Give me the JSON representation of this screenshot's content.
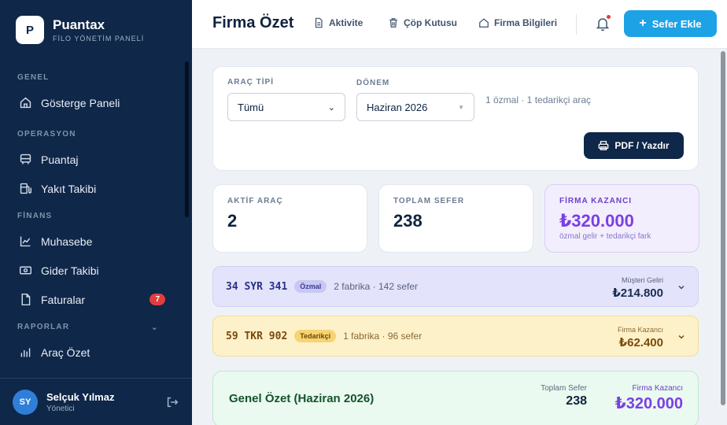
{
  "brand": {
    "logo_letter": "P",
    "name": "Puantax",
    "subtitle": "FİLO YÖNETİM PANELİ"
  },
  "sidebar": {
    "sections": [
      {
        "title": "GENEL",
        "items": [
          {
            "label": "Gösterge Paneli",
            "icon": "dashboard-icon"
          }
        ]
      },
      {
        "title": "OPERASYON",
        "items": [
          {
            "label": "Puantaj",
            "icon": "bus-icon"
          },
          {
            "label": "Yakıt Takibi",
            "icon": "fuel-icon"
          }
        ]
      },
      {
        "title": "FİNANS",
        "items": [
          {
            "label": "Muhasebe",
            "icon": "line-chart-icon"
          },
          {
            "label": "Gider Takibi",
            "icon": "money-icon"
          },
          {
            "label": "Faturalar",
            "icon": "document-icon",
            "badge": "7"
          }
        ]
      },
      {
        "title": "RAPORLAR",
        "collapsible": true,
        "items": [
          {
            "label": "Araç Özet",
            "icon": "bar-chart-icon"
          }
        ]
      }
    ],
    "user": {
      "initials": "SY",
      "name": "Selçuk Yılmaz",
      "role": "Yönetici"
    }
  },
  "topbar": {
    "title": "Firma Özet",
    "links": [
      {
        "label": "Aktivite",
        "icon": "activity-doc-icon"
      },
      {
        "label": "Çöp Kutusu",
        "icon": "trash-icon"
      },
      {
        "label": "Firma Bilgileri",
        "icon": "home-icon"
      }
    ],
    "primary_button": "Sefer Ekle"
  },
  "filters": {
    "vehicle_type_label": "ARAÇ TİPİ",
    "vehicle_type_value": "Tümü",
    "period_label": "DÖNEM",
    "period_value": "Haziran 2026",
    "summary_text": "1 özmal · 1 tedarikçi araç",
    "print_button": "PDF / Yazdır"
  },
  "stats": {
    "active_vehicles": {
      "label": "AKTİF ARAÇ",
      "value": "2"
    },
    "total_trips": {
      "label": "TOPLAM SEFER",
      "value": "238"
    },
    "company_profit": {
      "label": "FİRMA KAZANCI",
      "value": "₺320.000",
      "sub": "özmal gelir + tedarikçi fark"
    }
  },
  "vehicles": [
    {
      "plate": "34 SYR 341",
      "tag": "Özmal",
      "meta": "2 fabrika · 142 sefer",
      "amount_label": "Müşteri Geliri",
      "amount": "₺214.800"
    },
    {
      "plate": "59 TKR 902",
      "tag": "Tedarikçi",
      "meta": "1 fabrika · 96 sefer",
      "amount_label": "Firma Kazancı",
      "amount": "₺62.400"
    }
  ],
  "summary": {
    "title": "Genel Özet (Haziran 2026)",
    "trips_label": "Toplam Sefer",
    "trips_value": "238",
    "profit_label": "Firma Kazancı",
    "profit_value": "₺320.000"
  },
  "colors": {
    "sidebar_bg": "#0f2748",
    "accent": "#1ea2e6",
    "purple": "#7b3fe4",
    "badge_red": "#e23d3d",
    "ozmal_row": "#e3e4fb",
    "tedarikci_row": "#fdf1c9",
    "summary_row": "#eafaf0"
  }
}
